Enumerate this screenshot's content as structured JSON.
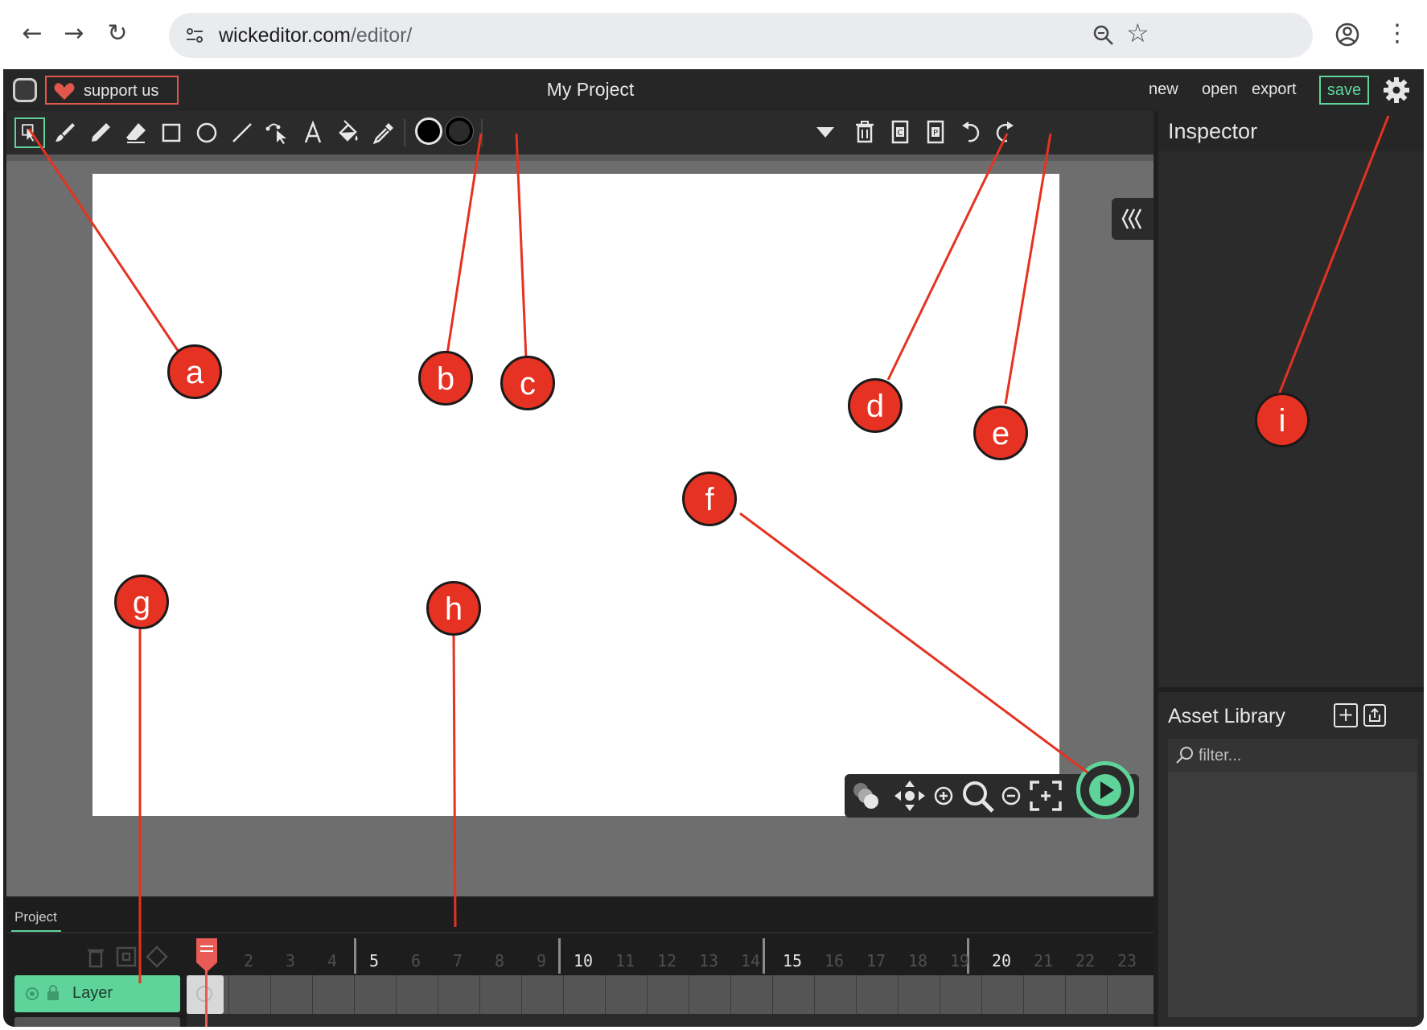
{
  "browser": {
    "url_host": "wickeditor.com",
    "url_path": "/editor/"
  },
  "topbar": {
    "support_label": "support us",
    "project_title": "My Project",
    "menu": [
      "new",
      "open",
      "export"
    ],
    "save_label": "save"
  },
  "inspector": {
    "title": "Inspector"
  },
  "assets": {
    "title": "Asset Library",
    "filter_placeholder": "filter..."
  },
  "timeline": {
    "tab_label": "Project",
    "layer_name": "Layer",
    "add_layer_label": "+",
    "frame_numbers": [
      "2",
      "3",
      "4",
      "5",
      "6",
      "7",
      "8",
      "9",
      "10",
      "11",
      "12",
      "13",
      "14",
      "15",
      "16",
      "17",
      "18",
      "19",
      "20",
      "21",
      "22",
      "23"
    ]
  },
  "callouts": [
    "a",
    "b",
    "c",
    "d",
    "e",
    "f",
    "g",
    "h",
    "i"
  ],
  "colors": {
    "accent_green": "#5ed49a",
    "support_border": "#e2574c",
    "callout_red": "#e53222",
    "playhead_red": "#e85a55"
  }
}
